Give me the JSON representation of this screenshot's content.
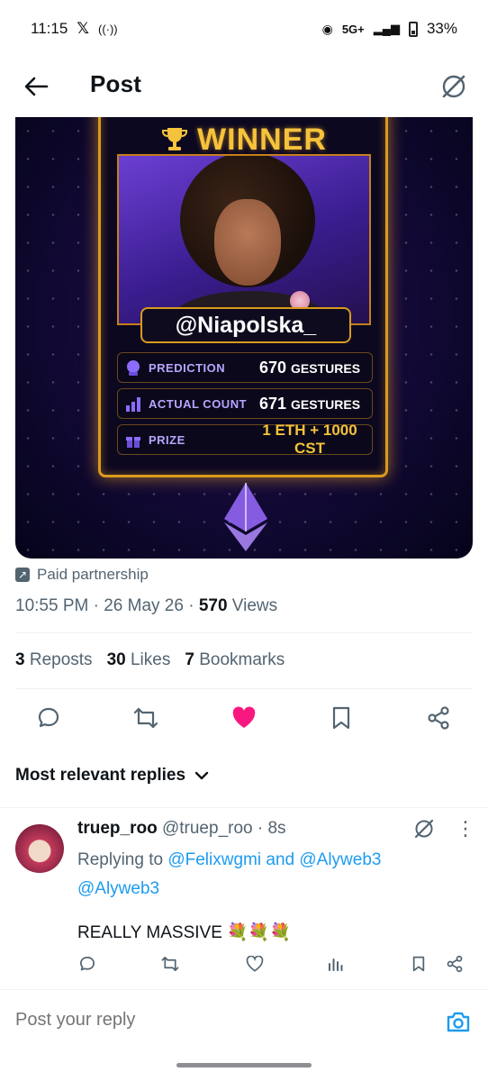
{
  "status_bar": {
    "time": "11:15",
    "network": "5G+",
    "battery": "33%"
  },
  "header": {
    "title": "Post"
  },
  "post_image": {
    "winner_text": "WINNER",
    "handle": "@Niapolska_",
    "stats": [
      {
        "label": "PREDICTION",
        "value": "670",
        "unit": "GESTURES"
      },
      {
        "label": "ACTUAL COUNT",
        "value": "671",
        "unit": "GESTURES"
      },
      {
        "label": "PRIZE",
        "value": "1 ETH + 1000 CST",
        "unit": ""
      }
    ]
  },
  "meta": {
    "paid_label": "Paid partnership",
    "time": "10:55 PM · 26 May 26 · ",
    "views_count": "570",
    "views_label": " Views"
  },
  "engagement": {
    "reposts_count": "3",
    "reposts_label": "Reposts",
    "likes_count": "30",
    "likes_label": "Likes",
    "bookmarks_count": "7",
    "bookmarks_label": "Bookmarks"
  },
  "replies_section": {
    "heading": "Most relevant replies"
  },
  "reply": {
    "display_name": "truep_roo",
    "handle": "@truep_roo",
    "time": "· 8s",
    "replying_prefix": "Replying to ",
    "mention_1": "@Felixwgmi",
    "and_text": " and ",
    "mention_2": "@Alyweb3",
    "mention_3": "@Alyweb3",
    "text": "REALLY MASSIVE 💐💐💐"
  },
  "composer": {
    "placeholder": "Post your reply"
  },
  "colors": {
    "accent": "#1d9bf0",
    "like": "#f91880",
    "muted": "#536471",
    "gold": "#f5c23b"
  }
}
